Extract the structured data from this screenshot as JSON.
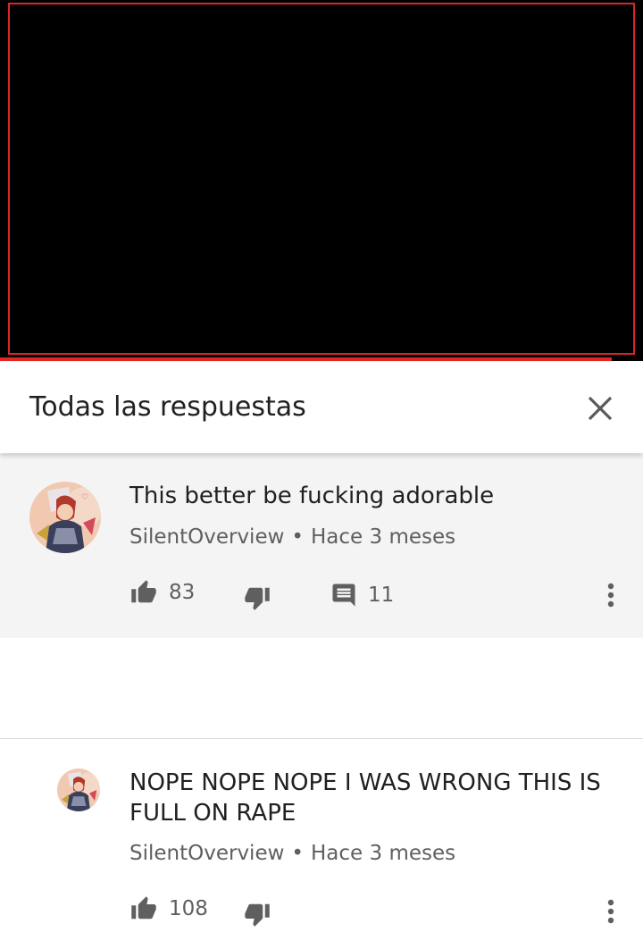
{
  "panel": {
    "title": "Todas las respuestas",
    "close_icon": "close-icon"
  },
  "main_comment": {
    "text": "This better be fucking adorable",
    "author": "SilentOverview",
    "separator": "•",
    "time": "Hace 3 meses",
    "likes": "83",
    "replies": "11"
  },
  "reply_comment": {
    "text": "NOPE NOPE NOPE I WAS WRONG THIS IS FULL ON RAPE",
    "author": "SilentOverview",
    "separator": "•",
    "time": "Hace 3 meses",
    "likes": "108"
  },
  "colors": {
    "accent": "#e52521",
    "background_highlight": "#f4f4f4",
    "icon": "#5f5f5f",
    "text_secondary": "#5f5f5f"
  },
  "video": {
    "progress": 0.951
  }
}
